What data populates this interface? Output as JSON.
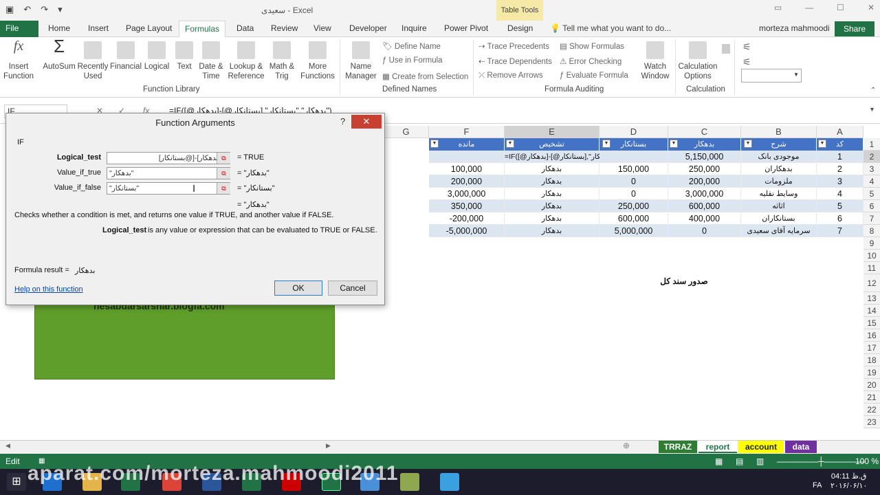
{
  "titlebar": {
    "doc_title": "سعیدی - Excel",
    "table_tools": "Table Tools",
    "user": "morteza mahmoodi",
    "share": "Share"
  },
  "tabs": [
    "File",
    "Home",
    "Insert",
    "Page Layout",
    "Formulas",
    "Data",
    "Review",
    "View",
    "Developer",
    "Inquire",
    "Power Pivot",
    "Design"
  ],
  "tell_me": "Tell me what you want to do...",
  "ribbon": {
    "insert_function": "Insert\nFunction",
    "autosum": "AutoSum",
    "recently_used": "Recently\nUsed",
    "financial": "Financial",
    "logical": "Logical",
    "text": "Text",
    "date_time": "Date &\nTime",
    "lookup": "Lookup &\nReference",
    "math": "Math &\nTrig",
    "more": "More\nFunctions",
    "function_library": "Function Library",
    "name_manager": "Name\nManager",
    "define_name": "Define Name",
    "use_in_formula": "Use in Formula",
    "create_from_selection": "Create from Selection",
    "defined_names": "Defined Names",
    "trace_precedents": "Trace Precedents",
    "trace_dependents": "Trace Dependents",
    "remove_arrows": "Remove Arrows",
    "show_formulas": "Show Formulas",
    "error_checking": "Error Checking",
    "evaluate_formula": "Evaluate Formula",
    "watch_window": "Watch\nWindow",
    "formula_auditing": "Formula Auditing",
    "calc_options": "Calculation\nOptions",
    "calculation": "Calculation"
  },
  "formula_bar": {
    "name_box": "IF",
    "formula": "=IF([@بدهکار]-[@بستانکار],\"بدهکار\",\"بستانکار\")"
  },
  "columns": [
    "G",
    "F",
    "E",
    "D",
    "C",
    "B",
    "A"
  ],
  "table_headers": {
    "F": "مانده",
    "E": "تشخیص",
    "D": "بستانکار",
    "C": "بدهکار",
    "B": "شرح",
    "A": "کد"
  },
  "rows": [
    {
      "A": "1",
      "B": "موجودی بانک",
      "C": "5,150,000",
      "D": "",
      "E": "=IF([@بدهکار]-[@بستانکار],\"بدهکار\",\"بستانکار\")",
      "F": ""
    },
    {
      "A": "2",
      "B": "بدهکاران",
      "C": "250,000",
      "D": "150,000",
      "E": "بدهکار",
      "F": "100,000"
    },
    {
      "A": "3",
      "B": "ملزومات",
      "C": "200,000",
      "D": "0",
      "E": "بدهکار",
      "F": "200,000"
    },
    {
      "A": "4",
      "B": "وسایط نقلیه",
      "C": "3,000,000",
      "D": "0",
      "E": "بدهکار",
      "F": "3,000,000"
    },
    {
      "A": "5",
      "B": "اثاثه",
      "C": "600,000",
      "D": "250,000",
      "E": "بدهکار",
      "F": "350,000"
    },
    {
      "A": "6",
      "B": "بستانکاران",
      "C": "400,000",
      "D": "600,000",
      "E": "بدهکار",
      "F": "-200,000"
    },
    {
      "A": "7",
      "B": "سرمایه آقای سعیدی",
      "C": "0",
      "D": "5,000,000",
      "E": "بدهکار",
      "F": "-5,000,000"
    }
  ],
  "row_numbers": [
    "1",
    "2",
    "3",
    "4",
    "5",
    "6",
    "7",
    "8",
    "9",
    "10",
    "11",
    "12",
    "13",
    "14",
    "15",
    "16",
    "17",
    "18",
    "19",
    "20",
    "21",
    "22",
    "23"
  ],
  "sanad_label": "صدور سند کل",
  "green_text": "hesabdarsarshar.blogfa.com",
  "dialog": {
    "title": "Function Arguments",
    "function": "IF",
    "logical_test_label": "Logical_test",
    "logical_test_value": "[@بدهکار]-[@بستانکار]",
    "logical_test_result": "TRUE",
    "value_true_label": "Value_if_true",
    "value_true_value": "\"بدهکار\"",
    "value_true_result": "\"بدهکار\"",
    "value_false_label": "Value_if_false",
    "value_false_value": "\"بستانکار\"",
    "value_false_result": "\"بستانکار\"",
    "overall_result": "\"بدهکار\"",
    "description": "Checks whether a condition is met, and returns one value if TRUE, and another value if FALSE.",
    "arg_name": "Logical_test",
    "arg_desc": "is any value or expression that can be evaluated to TRUE or FALSE.",
    "formula_result_label": "Formula result =",
    "formula_result_value": "بدهکار",
    "help_link": "Help on this function",
    "ok": "OK",
    "cancel": "Cancel"
  },
  "sheet_tabs": [
    "TRRAZ",
    "report",
    "account",
    "data"
  ],
  "status": {
    "mode": "Edit",
    "zoom": "100 %"
  },
  "watermark": "aparat.com/morteza.mahmoodi2011",
  "clock": {
    "time": "04:11 ق.ظ",
    "date": "۲۰۱۶/۰۶/۱۰",
    "lang": "FA"
  },
  "colors": {
    "excel_green": "#217346",
    "table_header": "#4472c4",
    "band": "#dce6f1",
    "green_box": "#5f9e2b"
  }
}
